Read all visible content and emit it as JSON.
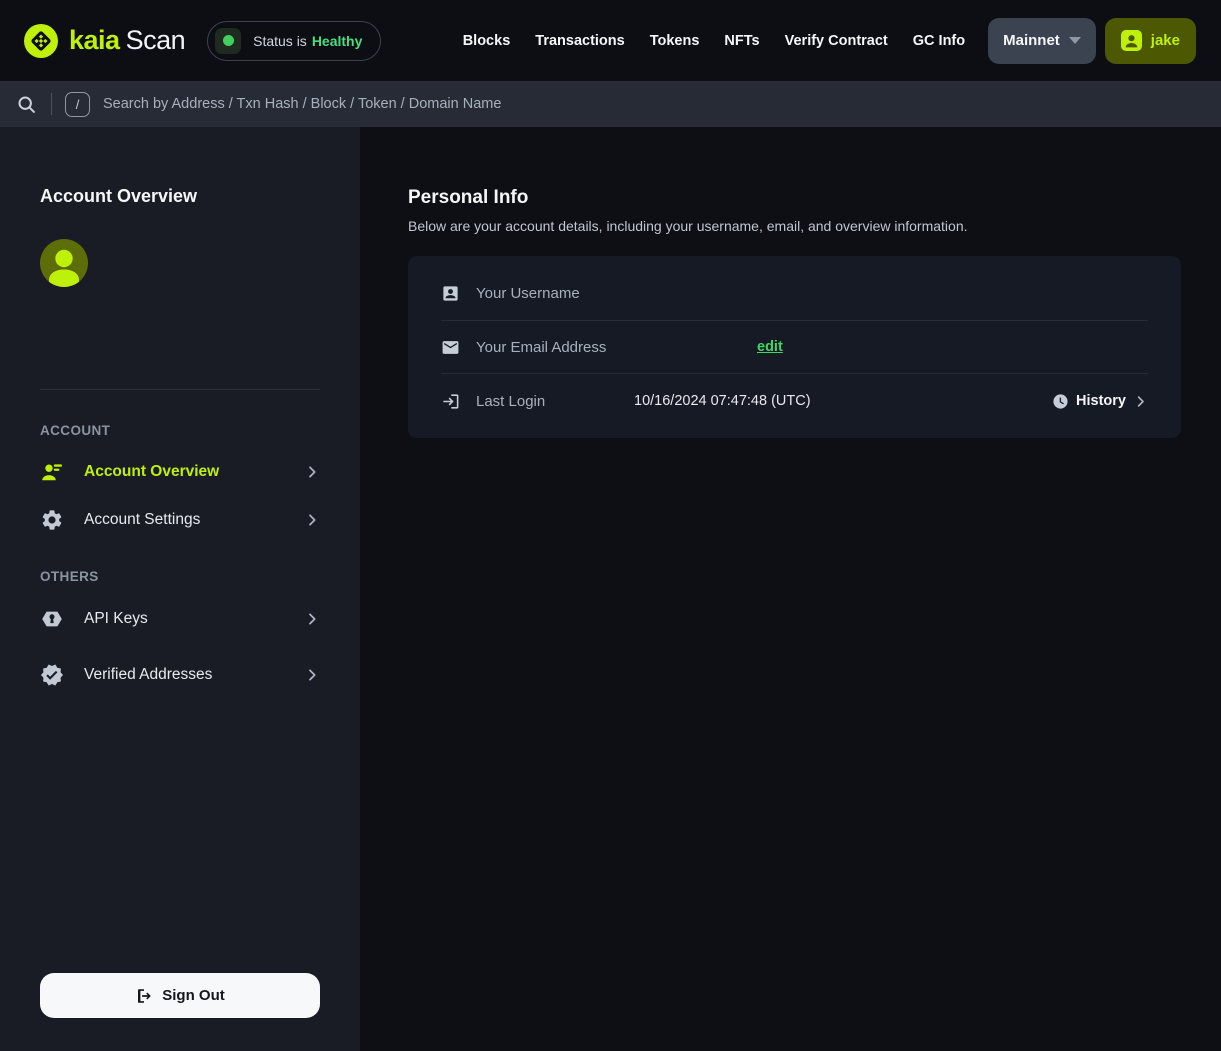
{
  "header": {
    "brand": {
      "name": "kaia",
      "suffix": "Scan"
    },
    "status": {
      "prefix": "Status is",
      "value": "Healthy"
    },
    "nav": {
      "blocks": "Blocks",
      "transactions": "Transactions",
      "tokens": "Tokens",
      "nfts": "NFTs",
      "verify_contract": "Verify Contract",
      "gc_info": "GC Info"
    },
    "network": {
      "label": "Mainnet"
    },
    "user": {
      "label": "jake"
    }
  },
  "search": {
    "shortcut": "/",
    "placeholder": "Search by Address / Txn Hash / Block / Token / Domain Name"
  },
  "sidebar": {
    "title": "Account Overview",
    "section_account": "ACCOUNT",
    "section_others": "OTHERS",
    "items": [
      {
        "label": "Account Overview",
        "active": true
      },
      {
        "label": "Account Settings",
        "active": false
      },
      {
        "label": "API Keys",
        "active": false
      },
      {
        "label": "Verified Addresses",
        "active": false
      }
    ],
    "signout_label": "Sign Out"
  },
  "main": {
    "title": "Personal Info",
    "description": "Below are your account details, including your username, email, and overview information.",
    "rows": [
      {
        "label": "Your Username",
        "value": ""
      },
      {
        "label": "Your Email Address",
        "value": "",
        "action": "edit"
      },
      {
        "label": "Last Login",
        "value": "10/16/2024 07:47:48 (UTC)",
        "action": "History"
      }
    ]
  },
  "colors": {
    "accent_lime": "#bff009",
    "green_healthy": "#4ade80",
    "green_edit": "#42d564",
    "header_bg": "#0c0e14",
    "searchbar_bg": "#262b36",
    "sidebar_bg": "#191c25",
    "main_bg": "#0d0f14",
    "card_bg": "#161a24",
    "user_button_bg": "#4c5902",
    "network_button_bg": "#3b4250"
  }
}
